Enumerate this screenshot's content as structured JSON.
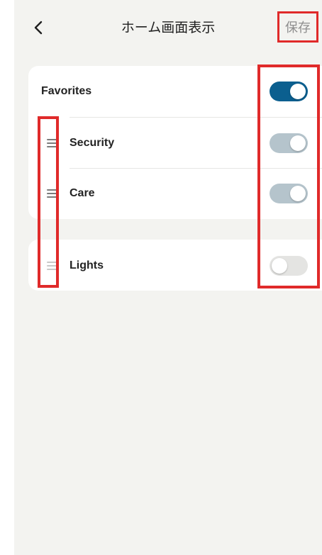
{
  "header": {
    "back_icon": "chevron-left-icon",
    "title": "ホーム画面表示",
    "save_label": "保存"
  },
  "favorites": {
    "label": "Favorites",
    "enabled": true
  },
  "sections": [
    {
      "label": "Security",
      "enabled": true,
      "drag_icon": "drag-handle-icon"
    },
    {
      "label": "Care",
      "enabled": true,
      "drag_icon": "drag-handle-icon"
    }
  ],
  "other_sections": [
    {
      "label": "Lights",
      "enabled": false,
      "drag_icon": "drag-handle-icon"
    }
  ],
  "colors": {
    "toggle_primary": "#0b5f8f",
    "toggle_muted": "#b5c4cc",
    "toggle_off": "#e4e4e2",
    "highlight": "#e02a2a",
    "background": "#f3f3f0"
  }
}
